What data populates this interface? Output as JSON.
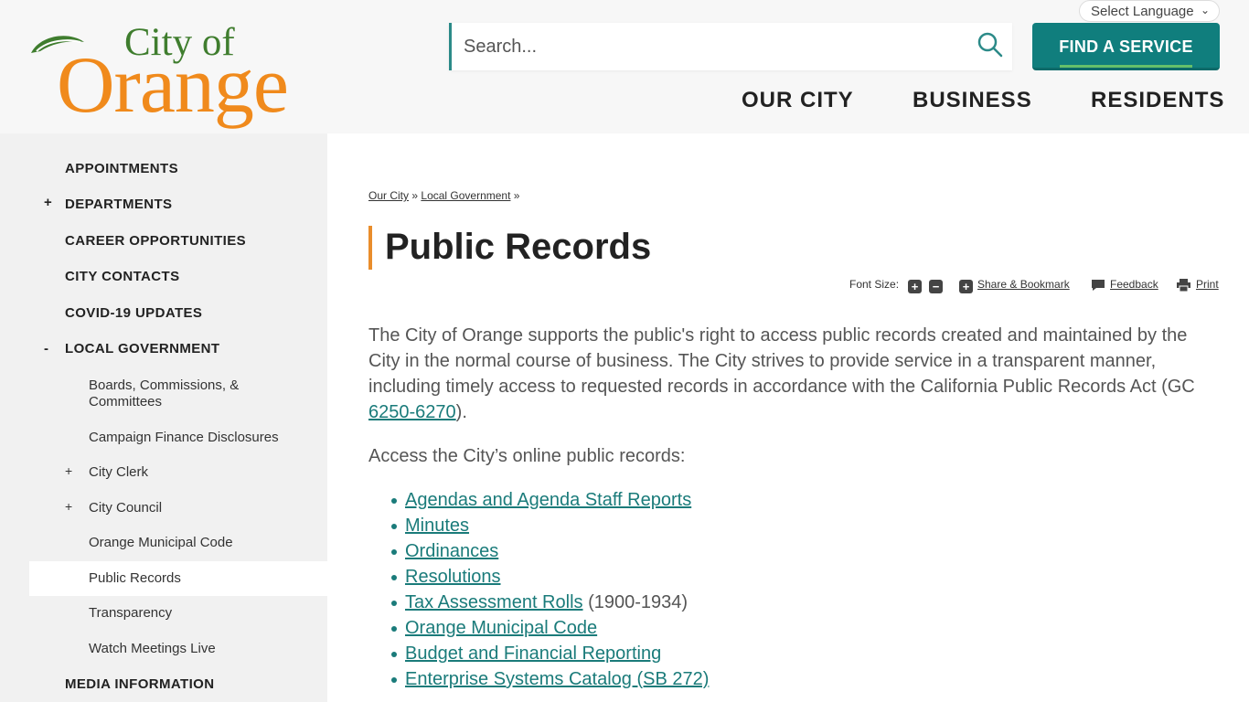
{
  "header": {
    "logo_line1": "City of",
    "logo_line2": "Orange",
    "language": "Select Language",
    "search_placeholder": "Search...",
    "find_service": "FIND A SERVICE",
    "nav": [
      "OUR CITY",
      "BUSINESS",
      "RESIDENTS"
    ]
  },
  "sidebar": {
    "items": [
      {
        "label": "APPOINTMENTS",
        "level": 1,
        "toggle": ""
      },
      {
        "label": "DEPARTMENTS",
        "level": 1,
        "toggle": "+"
      },
      {
        "label": "CAREER OPPORTUNITIES",
        "level": 1,
        "toggle": ""
      },
      {
        "label": "CITY CONTACTS",
        "level": 1,
        "toggle": ""
      },
      {
        "label": "COVID-19 UPDATES",
        "level": 1,
        "toggle": ""
      },
      {
        "label": "LOCAL GOVERNMENT",
        "level": 1,
        "toggle": "-"
      },
      {
        "label": "Boards, Commissions, & Committees",
        "level": 2,
        "toggle": ""
      },
      {
        "label": "Campaign Finance Disclosures",
        "level": 2,
        "toggle": ""
      },
      {
        "label": "City Clerk",
        "level": 2,
        "toggle": "+"
      },
      {
        "label": "City Council",
        "level": 2,
        "toggle": "+"
      },
      {
        "label": "Orange Municipal Code",
        "level": 2,
        "toggle": ""
      },
      {
        "label": "Public Records",
        "level": 2,
        "toggle": "",
        "active": true
      },
      {
        "label": "Transparency",
        "level": 2,
        "toggle": ""
      },
      {
        "label": "Watch Meetings Live",
        "level": 2,
        "toggle": ""
      },
      {
        "label": "MEDIA INFORMATION",
        "level": 1,
        "toggle": ""
      }
    ]
  },
  "breadcrumb": {
    "items": [
      "Our City",
      "Local Government"
    ],
    "separator": "»"
  },
  "page": {
    "title": "Public Records"
  },
  "tools": {
    "font_size_label": "Font Size:",
    "increase": "+",
    "decrease": "−",
    "share_label": "Share & Bookmark",
    "feedback_label": "Feedback",
    "print_label": "Print"
  },
  "content": {
    "intro_text": "The City of Orange supports the public's right to access public records created and maintained by the City in the normal course of business. The City strives to provide service in a transparent manner, including timely access to requested records in accordance with the California Public Records Act (GC ",
    "intro_link": "6250-6270",
    "intro_end": ").",
    "access_text": "Access the City’s online public records:",
    "links": [
      {
        "label": "Agendas and Agenda Staff Reports",
        "suffix": ""
      },
      {
        "label": "Minutes",
        "suffix": ""
      },
      {
        "label": "Ordinances",
        "suffix": ""
      },
      {
        "label": "Resolutions",
        "suffix": ""
      },
      {
        "label": "Tax Assessment Rolls",
        "suffix": " (1900-1934)"
      },
      {
        "label": "Orange Municipal Code",
        "suffix": ""
      },
      {
        "label": "Budget and Financial Reporting",
        "suffix": ""
      },
      {
        "label": "Enterprise Systems Catalog (SB 272)",
        "suffix": ""
      }
    ]
  },
  "colors": {
    "teal": "#107e7d",
    "link": "#1a7b7a",
    "orange": "#f08a1c",
    "green": "#3f7d2e",
    "title_accent": "#e98d2c"
  }
}
